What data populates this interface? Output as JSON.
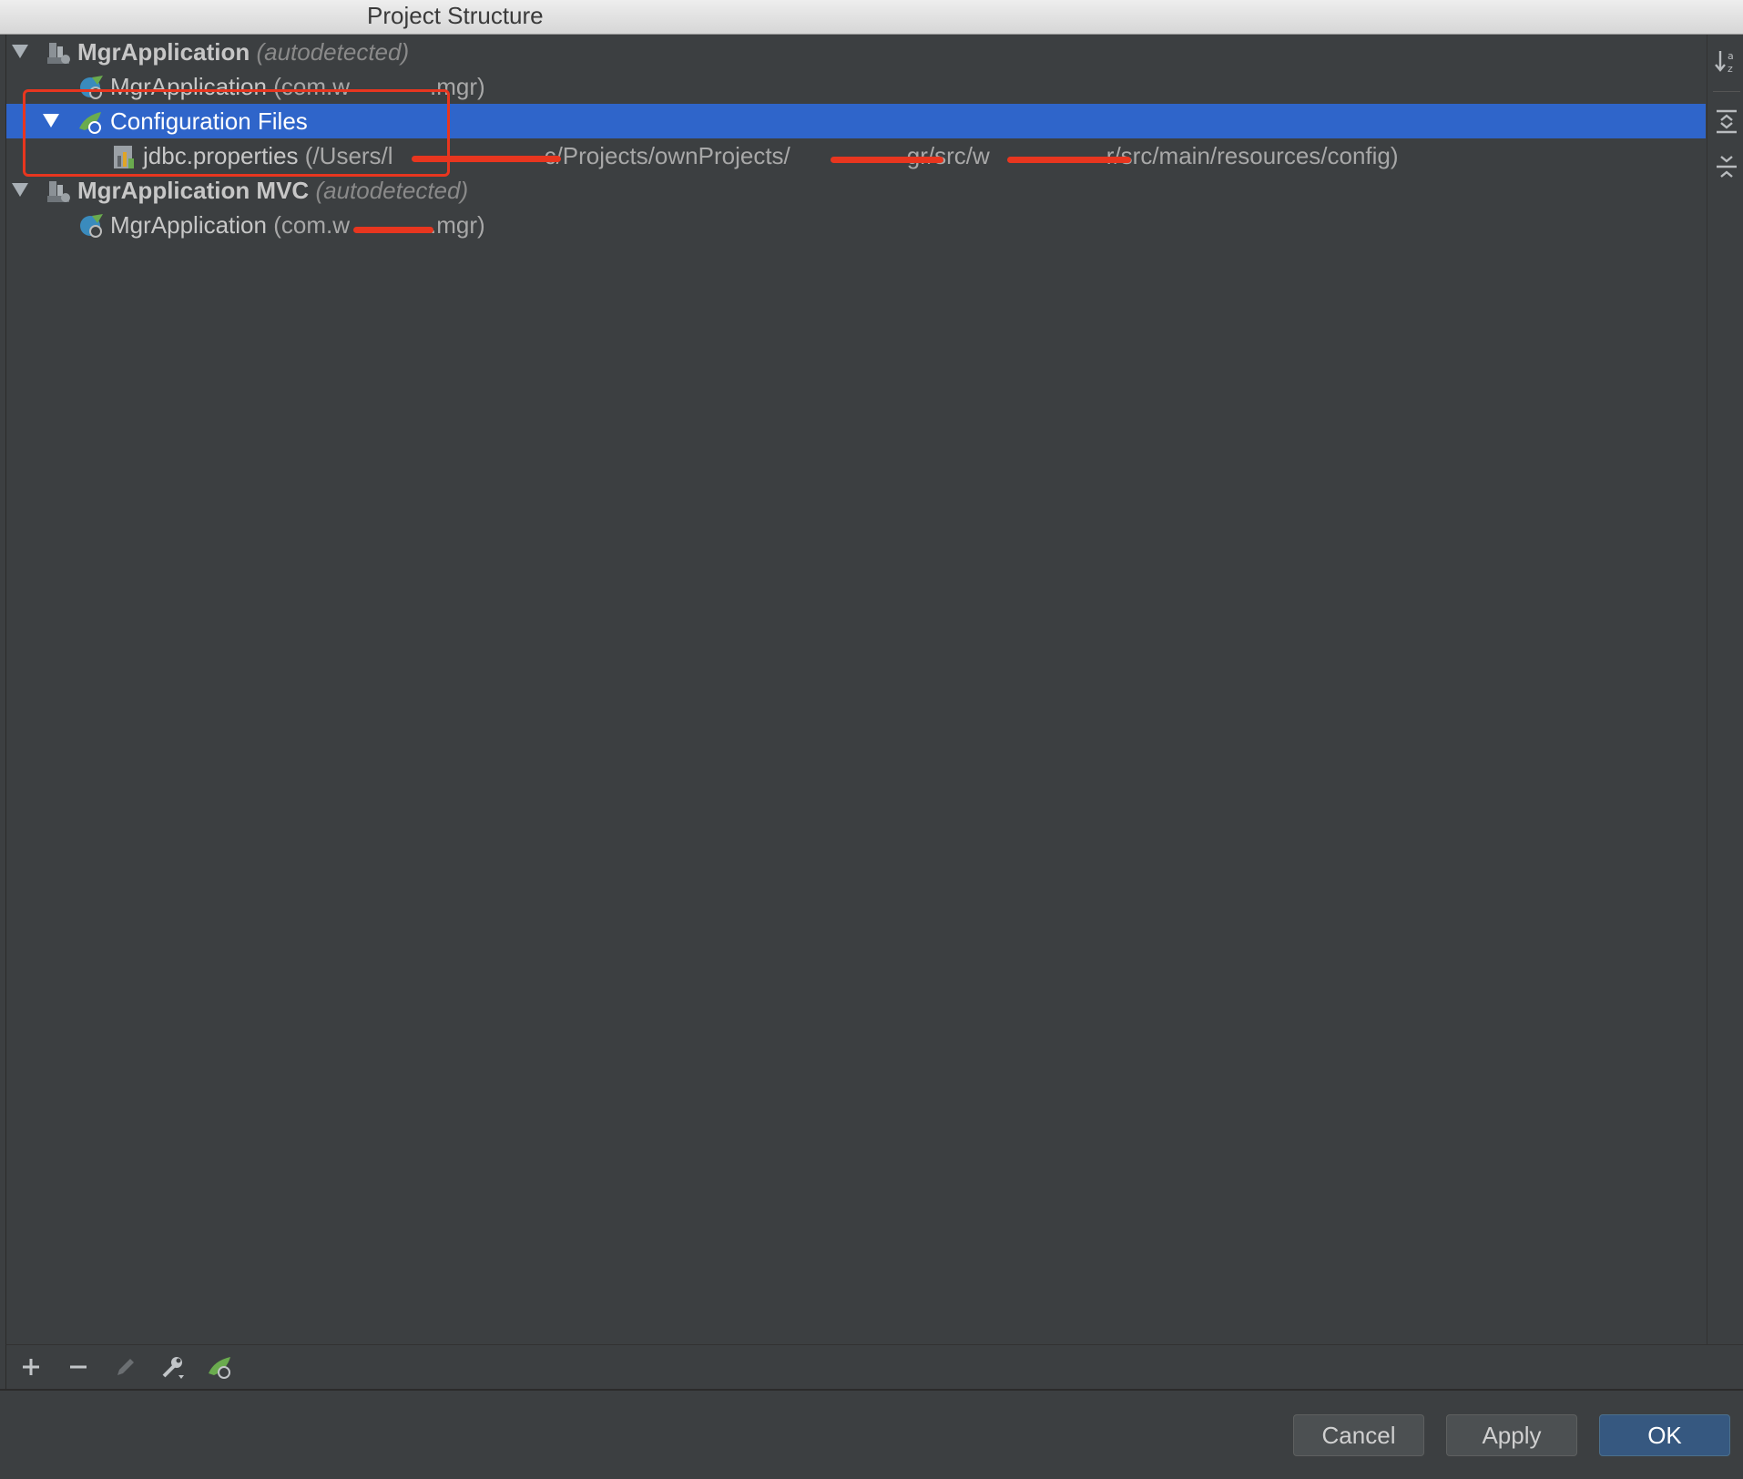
{
  "window": {
    "title": "Project Structure"
  },
  "tree": {
    "node1": {
      "name": "MgrApplication",
      "suffix": "(autodetected)"
    },
    "node1_child": {
      "name": "MgrApplication",
      "pkg_open": "(com.w",
      "pkg_close": ".mgr)"
    },
    "config": {
      "label": "Configuration Files"
    },
    "config_file": {
      "name": "jdbc.properties",
      "path_1": "(/Users/l",
      "path_2": "c/Projects/ownProjects/",
      "path_3": "gr/src/w",
      "path_4": "r/src/main/resources/config)"
    },
    "node2": {
      "name": "MgrApplication MVC",
      "suffix": "(autodetected)"
    },
    "node2_child": {
      "name": "MgrApplication",
      "pkg_open": "(com.w",
      "pkg_close": ".mgr)"
    }
  },
  "side_toolbar": [
    "sort-alphabetically-icon",
    "expand-all-icon",
    "collapse-all-icon"
  ],
  "bottom_toolbar": [
    "add-icon",
    "remove-icon",
    "edit-icon",
    "settings-wrench-icon",
    "spring-facet-icon"
  ],
  "buttons": {
    "cancel": "Cancel",
    "apply": "Apply",
    "ok": "OK"
  },
  "colors": {
    "selection": "#2f65ca",
    "annotation_red": "#e8361f",
    "spring_green": "#6aab4e",
    "primary_button": "#365880"
  }
}
